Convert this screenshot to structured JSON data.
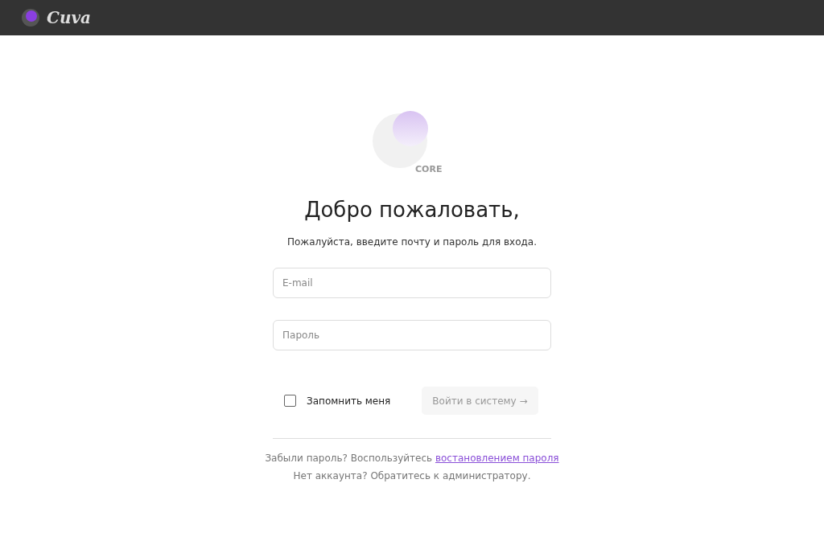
{
  "header": {
    "brand": "Cuva"
  },
  "logo": {
    "caption": "CORE"
  },
  "title": "Добро пожаловать,",
  "subtitle": "Пожалуйста, введите почту и пароль для входа.",
  "fields": [
    {
      "placeholder": "E-mail"
    },
    {
      "placeholder": "Пароль"
    }
  ],
  "remember": {
    "label": "Запомнить меня",
    "checked": false
  },
  "submit": {
    "label": "Войти в систему →",
    "disabled": true
  },
  "forgot": {
    "text": "Забыли пароль? Воспользуйтесь ",
    "link": "востановлением пароля"
  },
  "no_account": "Нет аккаунта? Обратитесь к администратору."
}
